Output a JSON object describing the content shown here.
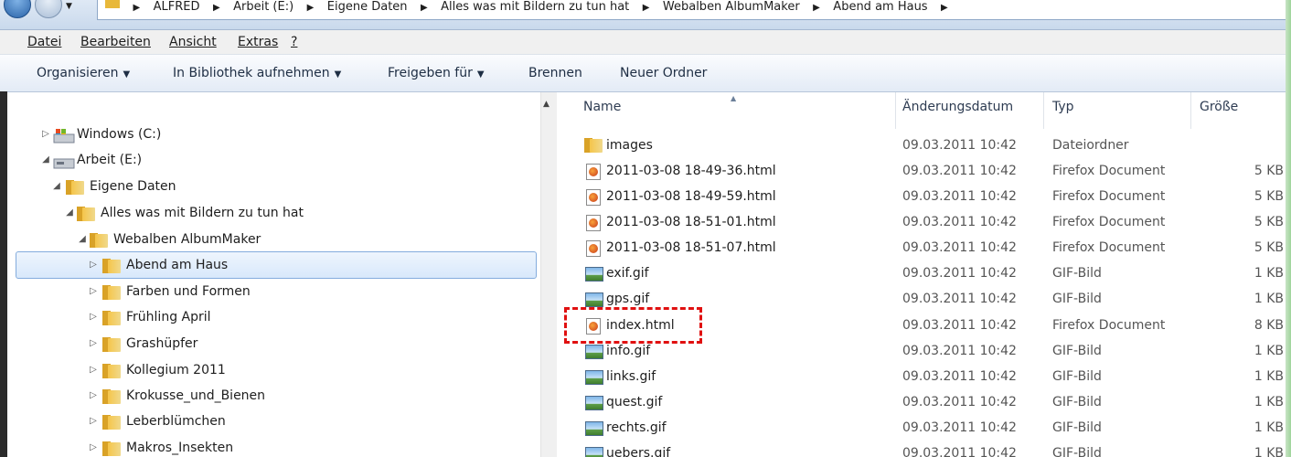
{
  "address": {
    "crumbs": [
      "ALFRED",
      "Arbeit (E:)",
      "Eigene Daten",
      "Alles was mit Bildern zu tun hat",
      "Webalben AlbumMaker",
      "Abend am Haus"
    ]
  },
  "menu": {
    "items": [
      "Datei",
      "Bearbeiten",
      "Ansicht",
      "Extras",
      "?"
    ]
  },
  "toolbar": {
    "organize": "Organisieren",
    "library": "In Bibliothek aufnehmen",
    "share": "Freigeben für",
    "burn": "Brennen",
    "new_folder": "Neuer Ordner"
  },
  "tree": {
    "items": [
      {
        "label": "Windows (C:)",
        "expand": "▷",
        "icon": "drive-icon"
      },
      {
        "label": "Arbeit (E:)",
        "expand": "◢",
        "icon": "drive-icon"
      },
      {
        "label": "Eigene Daten",
        "expand": "◢",
        "icon": "folder-icon"
      },
      {
        "label": "Alles was mit Bildern zu tun hat",
        "expand": "◢",
        "icon": "folder-icon"
      },
      {
        "label": "Webalben AlbumMaker",
        "expand": "◢",
        "icon": "folder-icon"
      },
      {
        "label": "Abend am Haus",
        "expand": "▷",
        "icon": "folder-icon",
        "selected": true
      },
      {
        "label": "Farben und Formen",
        "expand": "▷",
        "icon": "folder-icon"
      },
      {
        "label": "Frühling April",
        "expand": "▷",
        "icon": "folder-icon"
      },
      {
        "label": "Grashüpfer",
        "expand": "▷",
        "icon": "folder-icon"
      },
      {
        "label": "Kollegium 2011",
        "expand": "▷",
        "icon": "folder-icon"
      },
      {
        "label": "Krokusse_und_Bienen",
        "expand": "▷",
        "icon": "folder-icon"
      },
      {
        "label": "Leberblümchen",
        "expand": "▷",
        "icon": "folder-icon"
      },
      {
        "label": "Makros_Insekten",
        "expand": "▷",
        "icon": "folder-icon"
      }
    ]
  },
  "columns": {
    "name": "Name",
    "date": "Änderungsdatum",
    "type": "Typ",
    "size": "Größe"
  },
  "files": [
    {
      "name": "images",
      "date": "09.03.2011 10:42",
      "type": "Dateiordner",
      "size": "",
      "icon": "folder-icon"
    },
    {
      "name": "2011-03-08 18-49-36.html",
      "date": "09.03.2011 10:42",
      "type": "Firefox Document",
      "size": "5 KB",
      "icon": "firefox-document-icon"
    },
    {
      "name": "2011-03-08 18-49-59.html",
      "date": "09.03.2011 10:42",
      "type": "Firefox Document",
      "size": "5 KB",
      "icon": "firefox-document-icon"
    },
    {
      "name": "2011-03-08 18-51-01.html",
      "date": "09.03.2011 10:42",
      "type": "Firefox Document",
      "size": "5 KB",
      "icon": "firefox-document-icon"
    },
    {
      "name": "2011-03-08 18-51-07.html",
      "date": "09.03.2011 10:42",
      "type": "Firefox Document",
      "size": "5 KB",
      "icon": "firefox-document-icon"
    },
    {
      "name": "exif.gif",
      "date": "09.03.2011 10:42",
      "type": "GIF-Bild",
      "size": "1 KB",
      "icon": "gif-image-icon"
    },
    {
      "name": "gps.gif",
      "date": "09.03.2011 10:42",
      "type": "GIF-Bild",
      "size": "1 KB",
      "icon": "gif-image-icon"
    },
    {
      "name": "index.html",
      "date": "09.03.2011 10:42",
      "type": "Firefox Document",
      "size": "8 KB",
      "icon": "firefox-document-icon",
      "highlighted": true
    },
    {
      "name": "info.gif",
      "date": "09.03.2011 10:42",
      "type": "GIF-Bild",
      "size": "1 KB",
      "icon": "gif-image-icon"
    },
    {
      "name": "links.gif",
      "date": "09.03.2011 10:42",
      "type": "GIF-Bild",
      "size": "1 KB",
      "icon": "gif-image-icon"
    },
    {
      "name": "quest.gif",
      "date": "09.03.2011 10:42",
      "type": "GIF-Bild",
      "size": "1 KB",
      "icon": "gif-image-icon"
    },
    {
      "name": "rechts.gif",
      "date": "09.03.2011 10:42",
      "type": "GIF-Bild",
      "size": "1 KB",
      "icon": "gif-image-icon"
    },
    {
      "name": "uebers.gif",
      "date": "09.03.2011 10:42",
      "type": "GIF-Bild",
      "size": "1 KB",
      "icon": "gif-image-icon"
    }
  ],
  "colors": {
    "selection": "#d8e8fb",
    "highlight": "#e01010",
    "folder": "#f5c54a"
  }
}
